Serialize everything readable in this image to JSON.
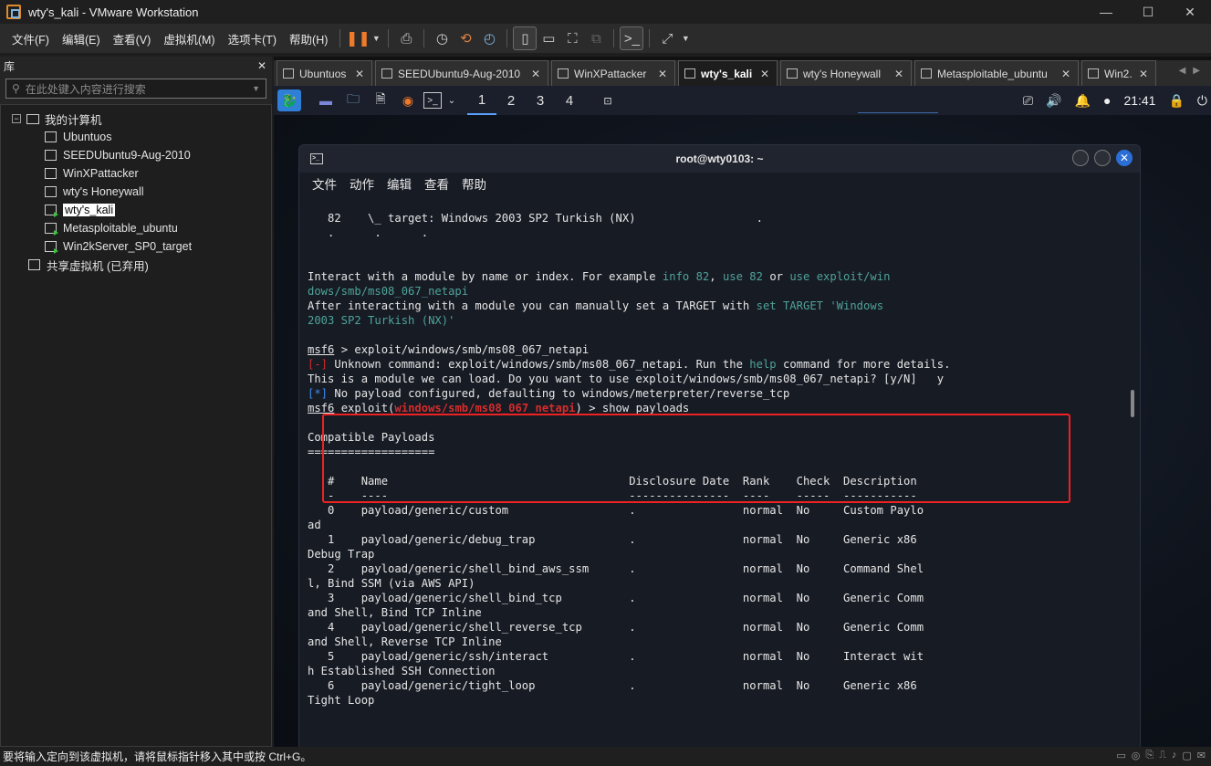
{
  "window": {
    "title": "wty's_kali - VMware Workstation",
    "min": "—",
    "max": "☐",
    "close": "✕"
  },
  "menu": [
    "文件(F)",
    "编辑(E)",
    "查看(V)",
    "虚拟机(M)",
    "选项卡(T)",
    "帮助(H)"
  ],
  "library": {
    "title": "库",
    "close": "✕",
    "search_placeholder": "在此处键入内容进行搜索",
    "root_expander": "−",
    "root": "我的计算机",
    "vms": [
      {
        "name": "Ubuntuos",
        "running": false
      },
      {
        "name": "SEEDUbuntu9-Aug-2010",
        "running": false
      },
      {
        "name": "WinXPattacker",
        "running": false
      },
      {
        "name": "wty's Honeywall",
        "running": false
      },
      {
        "name": "wty's_kali",
        "running": true
      },
      {
        "name": "Metasploitable_ubuntu",
        "running": true
      },
      {
        "name": "Win2kServer_SP0_target",
        "running": true
      }
    ],
    "shared": "共享虚拟机 (已弃用)"
  },
  "tabs": [
    {
      "label": "Ubuntuos",
      "active": false
    },
    {
      "label": "SEEDUbuntu9-Aug-2010",
      "active": false
    },
    {
      "label": "WinXPattacker",
      "active": false
    },
    {
      "label": "wty's_kali",
      "active": true
    },
    {
      "label": "wty's Honeywall",
      "active": false
    },
    {
      "label": "Metasploitable_ubuntu",
      "active": false
    },
    {
      "label": "Win2...",
      "active": false
    }
  ],
  "kali_panel": {
    "workspaces": [
      "1",
      "2",
      "3",
      "4"
    ],
    "clock": "21:41"
  },
  "terminal": {
    "title": "root@wty0103: ~",
    "menu": [
      "文件",
      "动作",
      "编辑",
      "查看",
      "帮助"
    ],
    "line_target": "   82    \\_ target: Windows 2003 SP2 Turkish (NX)                  .",
    "line_dots": "   .      .      .",
    "interact_a": "Interact with a module by name or index. For example ",
    "interact_info": "info 82",
    "interact_b": ", ",
    "interact_use": "use 82",
    "interact_c": " or ",
    "interact_use2": "use exploit/win",
    "interact_use3": "dows/smb/ms08_067_netapi",
    "after_a": "After interacting with a module you can manually set a TARGET with ",
    "after_set": "set TARGET 'Windows",
    "after_set2": "2003 SP2 Turkish (NX)'",
    "prompt": "msf6",
    "cmd1": " > exploit/windows/smb/ms08_067_netapi",
    "err_tag": "[-]",
    "err_a": " Unknown command: exploit/windows/smb/ms08_067_netapi. Run the ",
    "err_help": "help",
    "err_b": " command for more details.",
    "load_q": "This is a module we can load. Do you want to use exploit/windows/smb/ms08_067_netapi? [y/N]   y",
    "info_tag": "[*]",
    "info_msg": " No payload configured, defaulting to windows/meterpreter/reverse_tcp",
    "prompt2_a": " exploit(",
    "prompt2_mod": "windows/smb/ms08_067_netapi",
    "prompt2_b": ") > show payloads",
    "section": "Compatible Payloads",
    "section_rule": "===================",
    "header": "   #    Name                                    Disclosure Date  Rank    Check  Description",
    "header_rule": "   -    ----                                    ---------------  ----    -----  -----------",
    "rows": [
      "   0    payload/generic/custom                  .                normal  No     Custom Paylo",
      "ad",
      "   1    payload/generic/debug_trap              .                normal  No     Generic x86",
      "Debug Trap",
      "   2    payload/generic/shell_bind_aws_ssm      .                normal  No     Command Shel",
      "l, Bind SSM (via AWS API)",
      "   3    payload/generic/shell_bind_tcp          .                normal  No     Generic Comm",
      "and Shell, Bind TCP Inline",
      "   4    payload/generic/shell_reverse_tcp       .                normal  No     Generic Comm",
      "and Shell, Reverse TCP Inline",
      "   5    payload/generic/ssh/interact            .                normal  No     Interact wit",
      "h Established SSH Connection",
      "   6    payload/generic/tight_loop              .                normal  No     Generic x86",
      "Tight Loop"
    ]
  },
  "status": "要将输入定向到该虚拟机，请将鼠标指针移入其中或按 Ctrl+G。",
  "colors": {
    "accent_red": "#e22222",
    "kali_blue": "#2f7fd6",
    "cyan": "#4fa39a"
  }
}
